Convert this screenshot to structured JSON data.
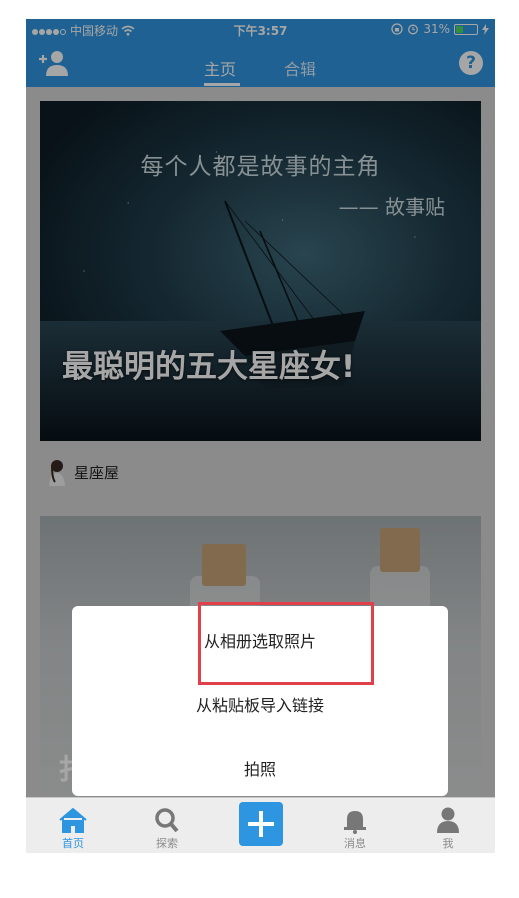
{
  "status_bar": {
    "carrier": "中国移动",
    "time": "下午3:57",
    "battery": "31%"
  },
  "nav": {
    "tabs": [
      {
        "label": "主页",
        "active": true
      },
      {
        "label": "合辑",
        "active": false
      }
    ],
    "help": "?"
  },
  "feed": [
    {
      "image_tagline": "每个人都是故事的主角",
      "image_signature": "—— 故事贴",
      "title": "最聪明的五大星座女!",
      "author": "星座屋"
    },
    {
      "title_partial": "扌"
    }
  ],
  "action_sheet": {
    "items": [
      "从相册选取照片",
      "从粘贴板导入链接",
      "拍照"
    ]
  },
  "tab_bar": {
    "items": [
      {
        "label": "首页",
        "icon": "home-icon",
        "active": true
      },
      {
        "label": "探索",
        "icon": "search-icon",
        "active": false
      },
      {
        "label": "",
        "icon": "plus-icon",
        "active": false
      },
      {
        "label": "消息",
        "icon": "bell-icon",
        "active": false
      },
      {
        "label": "我",
        "icon": "user-icon",
        "active": false
      }
    ]
  },
  "colors": {
    "brand": "#2e95e0",
    "highlight": "#e0404a"
  }
}
